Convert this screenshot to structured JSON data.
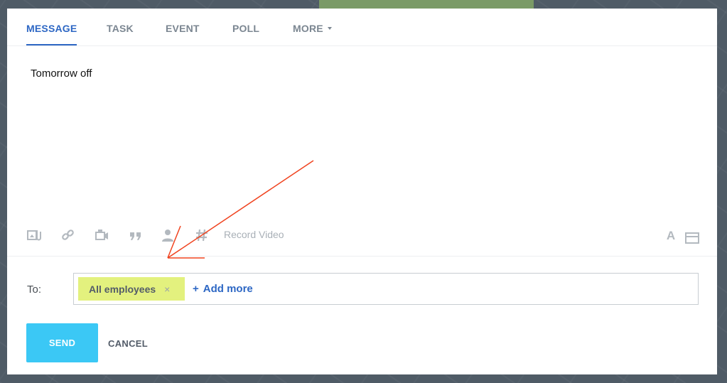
{
  "tabs": [
    {
      "label": "MESSAGE",
      "active": true
    },
    {
      "label": "TASK",
      "active": false
    },
    {
      "label": "EVENT",
      "active": false
    },
    {
      "label": "POLL",
      "active": false
    },
    {
      "label": "MORE",
      "active": false
    }
  ],
  "editor": {
    "text": "Tomorrow off"
  },
  "toolbar": {
    "icons": [
      "attach-file-icon",
      "link-icon",
      "video-icon",
      "quote-icon",
      "mention-user-icon",
      "hashtag-icon",
      "text-format-icon",
      "panel-icon"
    ],
    "record_video_label": "Record Video",
    "format_label": "A"
  },
  "recipients": {
    "to_label": "To:",
    "chips": [
      {
        "label": "All employees",
        "remove": "×"
      }
    ],
    "add_more_label": "Add more",
    "add_more_plus": "+"
  },
  "actions": {
    "send_label": "SEND",
    "cancel_label": "CANCEL"
  },
  "colors": {
    "accent": "#2d67c4",
    "send_button": "#3bc8f5",
    "chip_bg": "#e3f17e",
    "annotation_arrow": "#f0431f"
  }
}
